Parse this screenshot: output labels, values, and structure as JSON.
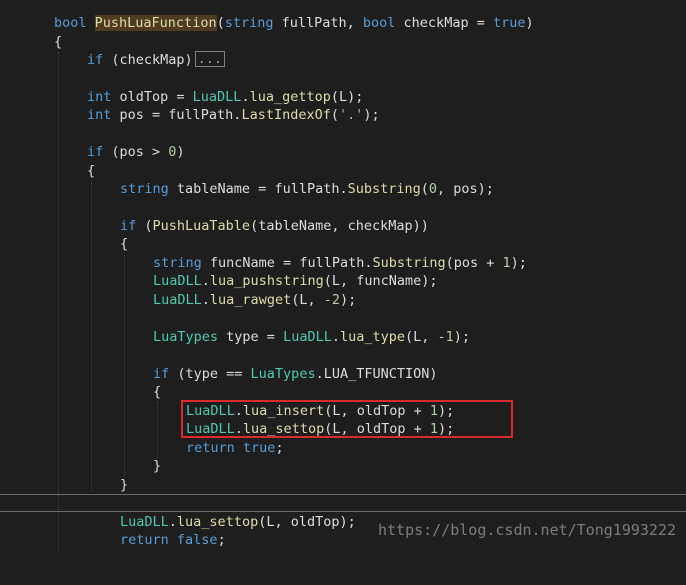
{
  "editor": {
    "sig": {
      "kw_bool": "bool",
      "name": "PushLuaFunction",
      "p1": "(",
      "kw_string": "string",
      "p2": " fullPath, ",
      "kw_bool2": "bool",
      "p3": " checkMap = ",
      "kw_true": "true",
      "p4": ")"
    },
    "brace_open_1": "{",
    "if_check": {
      "kw": "if",
      "rest": " (checkMap)",
      "collapsed": "..."
    },
    "oldtop": {
      "kw": "int",
      "a": " oldTop = ",
      "cls": "LuaDLL",
      "b": ".",
      "fn": "lua_gettop",
      "c": "(L);"
    },
    "pos": {
      "kw": "int",
      "a": " pos = fullPath.",
      "fn": "LastIndexOf",
      "b": "(",
      "str": "'.'",
      "c": ");"
    },
    "ifpos": {
      "kw": "if",
      "a": " (pos > ",
      "num": "0",
      "b": ")"
    },
    "brace_open_2": "{",
    "tablename": {
      "kw": "string",
      "a": " tableName = fullPath.",
      "fn": "Substring",
      "b": "(",
      "num": "0",
      "c": ", pos);"
    },
    "ifpush": {
      "kw": "if",
      "a": " (",
      "fn": "PushLuaTable",
      "b": "(tableName, checkMap))"
    },
    "brace_open_3": "{",
    "funcname": {
      "kw": "string",
      "a": " funcName = fullPath.",
      "fn": "Substring",
      "b": "(pos + ",
      "num": "1",
      "c": ");"
    },
    "pushstring": {
      "cls": "LuaDLL",
      "a": ".",
      "fn": "lua_pushstring",
      "b": "(L, funcName);"
    },
    "rawget": {
      "cls": "LuaDLL",
      "a": ".",
      "fn": "lua_rawget",
      "b": "(L, ",
      "num": "-2",
      "c": ");"
    },
    "luatype": {
      "cls": "LuaTypes",
      "a": " type = ",
      "cls2": "LuaDLL",
      "b": ".",
      "fn": "lua_type",
      "c": "(L, ",
      "num": "-1",
      "d": ");"
    },
    "iftype": {
      "kw": "if",
      "a": " (type == ",
      "cls": "LuaTypes",
      "b": ".LUA_TFUNCTION)"
    },
    "brace_open_4": "{",
    "insert": {
      "cls": "LuaDLL",
      "a": ".",
      "fn": "lua_insert",
      "b": "(L, oldTop + ",
      "num": "1",
      "c": ");"
    },
    "settop1": {
      "cls": "LuaDLL",
      "a": ".",
      "fn": "lua_settop",
      "b": "(L, oldTop + ",
      "num": "1",
      "c": ");"
    },
    "return_true": {
      "kw": "return",
      "kw2": "true",
      "c": ";"
    },
    "brace_close_4": "}",
    "brace_close_3": "}",
    "settop2": {
      "cls": "LuaDLL",
      "a": ".",
      "fn": "lua_settop",
      "b": "(L, oldTop);"
    },
    "return_false": {
      "kw": "return",
      "kw2": "false",
      "c": ";"
    }
  },
  "watermark": "https://blog.csdn.net/Tong1993222",
  "colors": {
    "keyword": "#569cd6",
    "type": "#4ec9b0",
    "method": "#dcdcaa",
    "number": "#b5cea8",
    "string": "#d69d85",
    "highlight_box": "#d92b2b",
    "background": "#1e1e1e"
  }
}
